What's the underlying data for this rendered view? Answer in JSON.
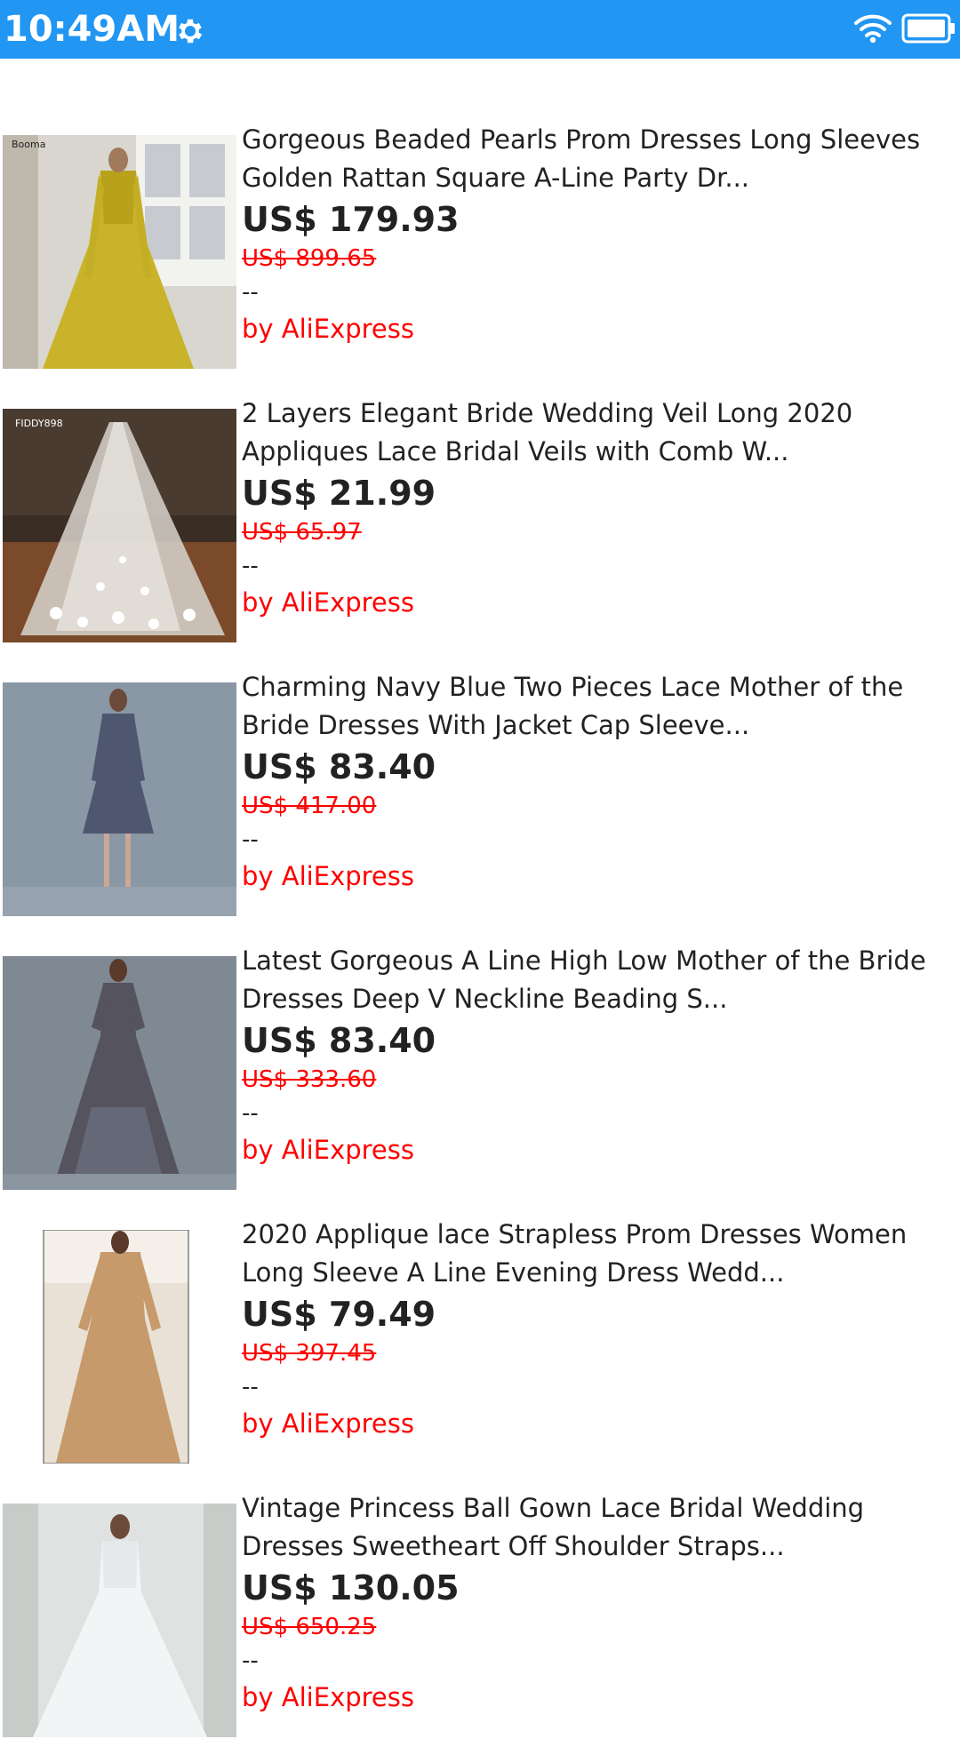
{
  "status_bar": {
    "time": "10:49AM",
    "bg_color": "#2196F3",
    "icons": [
      "gear-icon",
      "wifi-icon",
      "battery-icon"
    ]
  },
  "products": [
    {
      "title_line1": "Gorgeous Beaded Pearls Prom Dresses Long Sleeves",
      "title_line2": "Golden Rattan Square A-Line Party Dr...",
      "price": "US$ 179.93",
      "original_price": "US$ 899.65",
      "rating": "--",
      "seller": "by AliExpress",
      "image_label": "Booma"
    },
    {
      "title_line1": "2 Layers Elegant Bride Wedding Veil Long 2020",
      "title_line2": "Appliques Lace Bridal Veils with Comb W...",
      "price": "US$ 21.99",
      "original_price": "US$ 65.97",
      "rating": "--",
      "seller": "by AliExpress",
      "image_label": "FIDDY898"
    },
    {
      "title_line1": "Charming Navy Blue Two Pieces Lace Mother of the",
      "title_line2": "Bride Dresses With Jacket Cap Sleeve...",
      "price": "US$ 83.40",
      "original_price": "US$ 417.00",
      "rating": "--",
      "seller": "by AliExpress"
    },
    {
      "title_line1": "Latest Gorgeous A Line High Low Mother of the Bride",
      "title_line2": "Dresses Deep V Neckline Beading S...",
      "price": "US$ 83.40",
      "original_price": "US$ 333.60",
      "rating": "--",
      "seller": "by AliExpress"
    },
    {
      "title_line1": "2020 Applique lace Strapless Prom Dresses Women",
      "title_line2": "Long Sleeve A Line Evening Dress Wedd...",
      "price": "US$ 79.49",
      "original_price": "US$ 397.45",
      "rating": "--",
      "seller": "by AliExpress"
    },
    {
      "title_line1": "Vintage Princess Ball Gown Lace Bridal Wedding",
      "title_line2": "Dresses Sweetheart Off Shoulder Straps...",
      "price": "US$ 130.05",
      "original_price": "US$ 650.25",
      "rating": "--",
      "seller": "by AliExpress"
    }
  ]
}
